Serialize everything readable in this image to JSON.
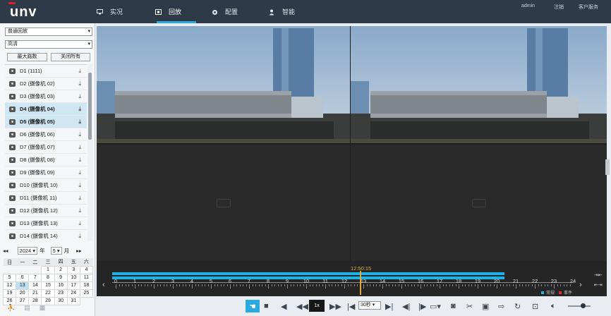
{
  "header": {
    "logo": "unv",
    "nav": [
      {
        "label": "实况",
        "icon": "monitor-icon"
      },
      {
        "label": "回放",
        "icon": "playback-icon"
      },
      {
        "label": "配置",
        "icon": "gear-icon"
      },
      {
        "label": "智能",
        "icon": "person-icon"
      }
    ],
    "active_nav": "回放",
    "user": "admin",
    "logout": "注销",
    "service": "客户服务"
  },
  "left": {
    "mode_select": "普通回放",
    "stream_select": "高清",
    "max_channels_button": "最大路数",
    "close_all_button": "关闭所有",
    "cameras": [
      {
        "label": "D1 (1111)",
        "selected": false
      },
      {
        "label": "D2 (摄像机 02)",
        "selected": false
      },
      {
        "label": "D3 (摄像机 03)",
        "selected": false
      },
      {
        "label": "D4 (摄像机 04)",
        "selected": true
      },
      {
        "label": "D5 (摄像机 05)",
        "selected": true
      },
      {
        "label": "D6 (摄像机 06)",
        "selected": false
      },
      {
        "label": "D7 (摄像机 07)",
        "selected": false
      },
      {
        "label": "D8 (摄像机 08)",
        "selected": false
      },
      {
        "label": "D9 (摄像机 09)",
        "selected": false
      },
      {
        "label": "D10 (摄像机 10)",
        "selected": false
      },
      {
        "label": "D11 (摄像机 11)",
        "selected": false
      },
      {
        "label": "D12 (摄像机 12)",
        "selected": false
      },
      {
        "label": "D13 (摄像机 13)",
        "selected": false
      },
      {
        "label": "D14 (摄像机 14)",
        "selected": false
      }
    ],
    "calendar": {
      "year": "2024",
      "year_unit": "年",
      "month": "5",
      "month_unit": "月",
      "weekdays": [
        "日",
        "一",
        "二",
        "三",
        "四",
        "五",
        "六"
      ],
      "weeks": [
        [
          "",
          "",
          "",
          "1",
          "2",
          "3",
          "4"
        ],
        [
          "5",
          "6",
          "7",
          "8",
          "9",
          "10",
          "11"
        ],
        [
          "12",
          "13",
          "14",
          "15",
          "16",
          "17",
          "18"
        ],
        [
          "19",
          "20",
          "21",
          "22",
          "23",
          "24",
          "25"
        ],
        [
          "26",
          "27",
          "28",
          "29",
          "30",
          "31",
          ""
        ]
      ],
      "today": "13"
    }
  },
  "timeline": {
    "current_time": "12:50:15",
    "hours": [
      "0",
      "1",
      "2",
      "3",
      "4",
      "5",
      "6",
      "7",
      "8",
      "9",
      "10",
      "11",
      "12",
      "13",
      "14",
      "15",
      "16",
      "17",
      "18",
      "19",
      "20",
      "21",
      "22",
      "23",
      "24"
    ],
    "legend": [
      {
        "label": "常规",
        "color": "#1eb3e6"
      },
      {
        "label": "事件",
        "color": "#e02d2d"
      }
    ]
  },
  "toolbar": {
    "speed": "1x",
    "interval": "30秒"
  }
}
